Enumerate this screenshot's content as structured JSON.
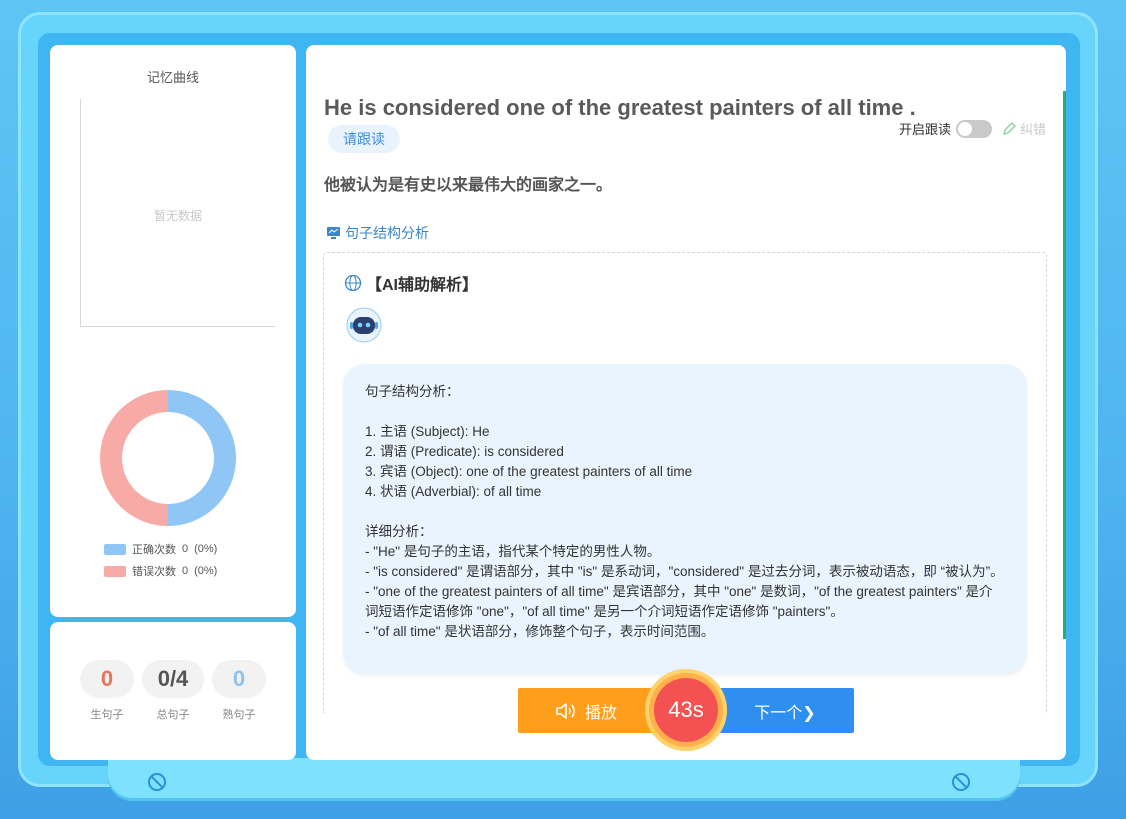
{
  "curve": {
    "title": "记忆曲线",
    "empty_text": "暂无数据"
  },
  "donut": {
    "correct": {
      "label": "正确次数",
      "count": "0",
      "percent": "(0%)",
      "color": "#8fc6f5"
    },
    "wrong": {
      "label": "错误次数",
      "count": "0",
      "percent": "(0%)",
      "color": "#f8aaa6"
    }
  },
  "stats": [
    {
      "value": "0",
      "label": "生句子",
      "color": "#e8745a"
    },
    {
      "value": "0/4",
      "label": "总句子",
      "color": "#555555"
    },
    {
      "value": "0",
      "label": "熟句子",
      "color": "#8fc3ec"
    }
  ],
  "sentence": {
    "english": "He is considered one of the greatest painters of all time .",
    "follow_tag": "请跟读",
    "translation": "他被认为是有史以来最伟大的画家之一。"
  },
  "controls": {
    "toggle_label": "开启跟读",
    "correct_label": "纠错",
    "analysis_link": "句子结构分析"
  },
  "ai": {
    "title": "【AI辅助解析】",
    "content": "句子结构分析：\n\n1. 主语 (Subject): He\n2. 谓语 (Predicate): is considered\n3. 宾语 (Object): one of the greatest painters of all time\n4. 状语 (Adverbial): of all time\n\n详细分析：\n- \"He\" 是句子的主语，指代某个特定的男性人物。\n- \"is considered\" 是谓语部分，其中 \"is\" 是系动词，\"considered\" 是过去分词，表示被动语态，即 “被认为”。\n- \"one of the greatest painters of all time\" 是宾语部分，其中 \"one\" 是数词，\"of the greatest painters\" 是介词短语作定语修饰 \"one\"，\"of all time\" 是另一个介词短语作定语修饰 \"painters\"。\n- \"of all time\" 是状语部分，修饰整个句子，表示时间范围。"
  },
  "bottom": {
    "play_label": "播放",
    "timer": "43s",
    "next_label": "下一个❯"
  }
}
